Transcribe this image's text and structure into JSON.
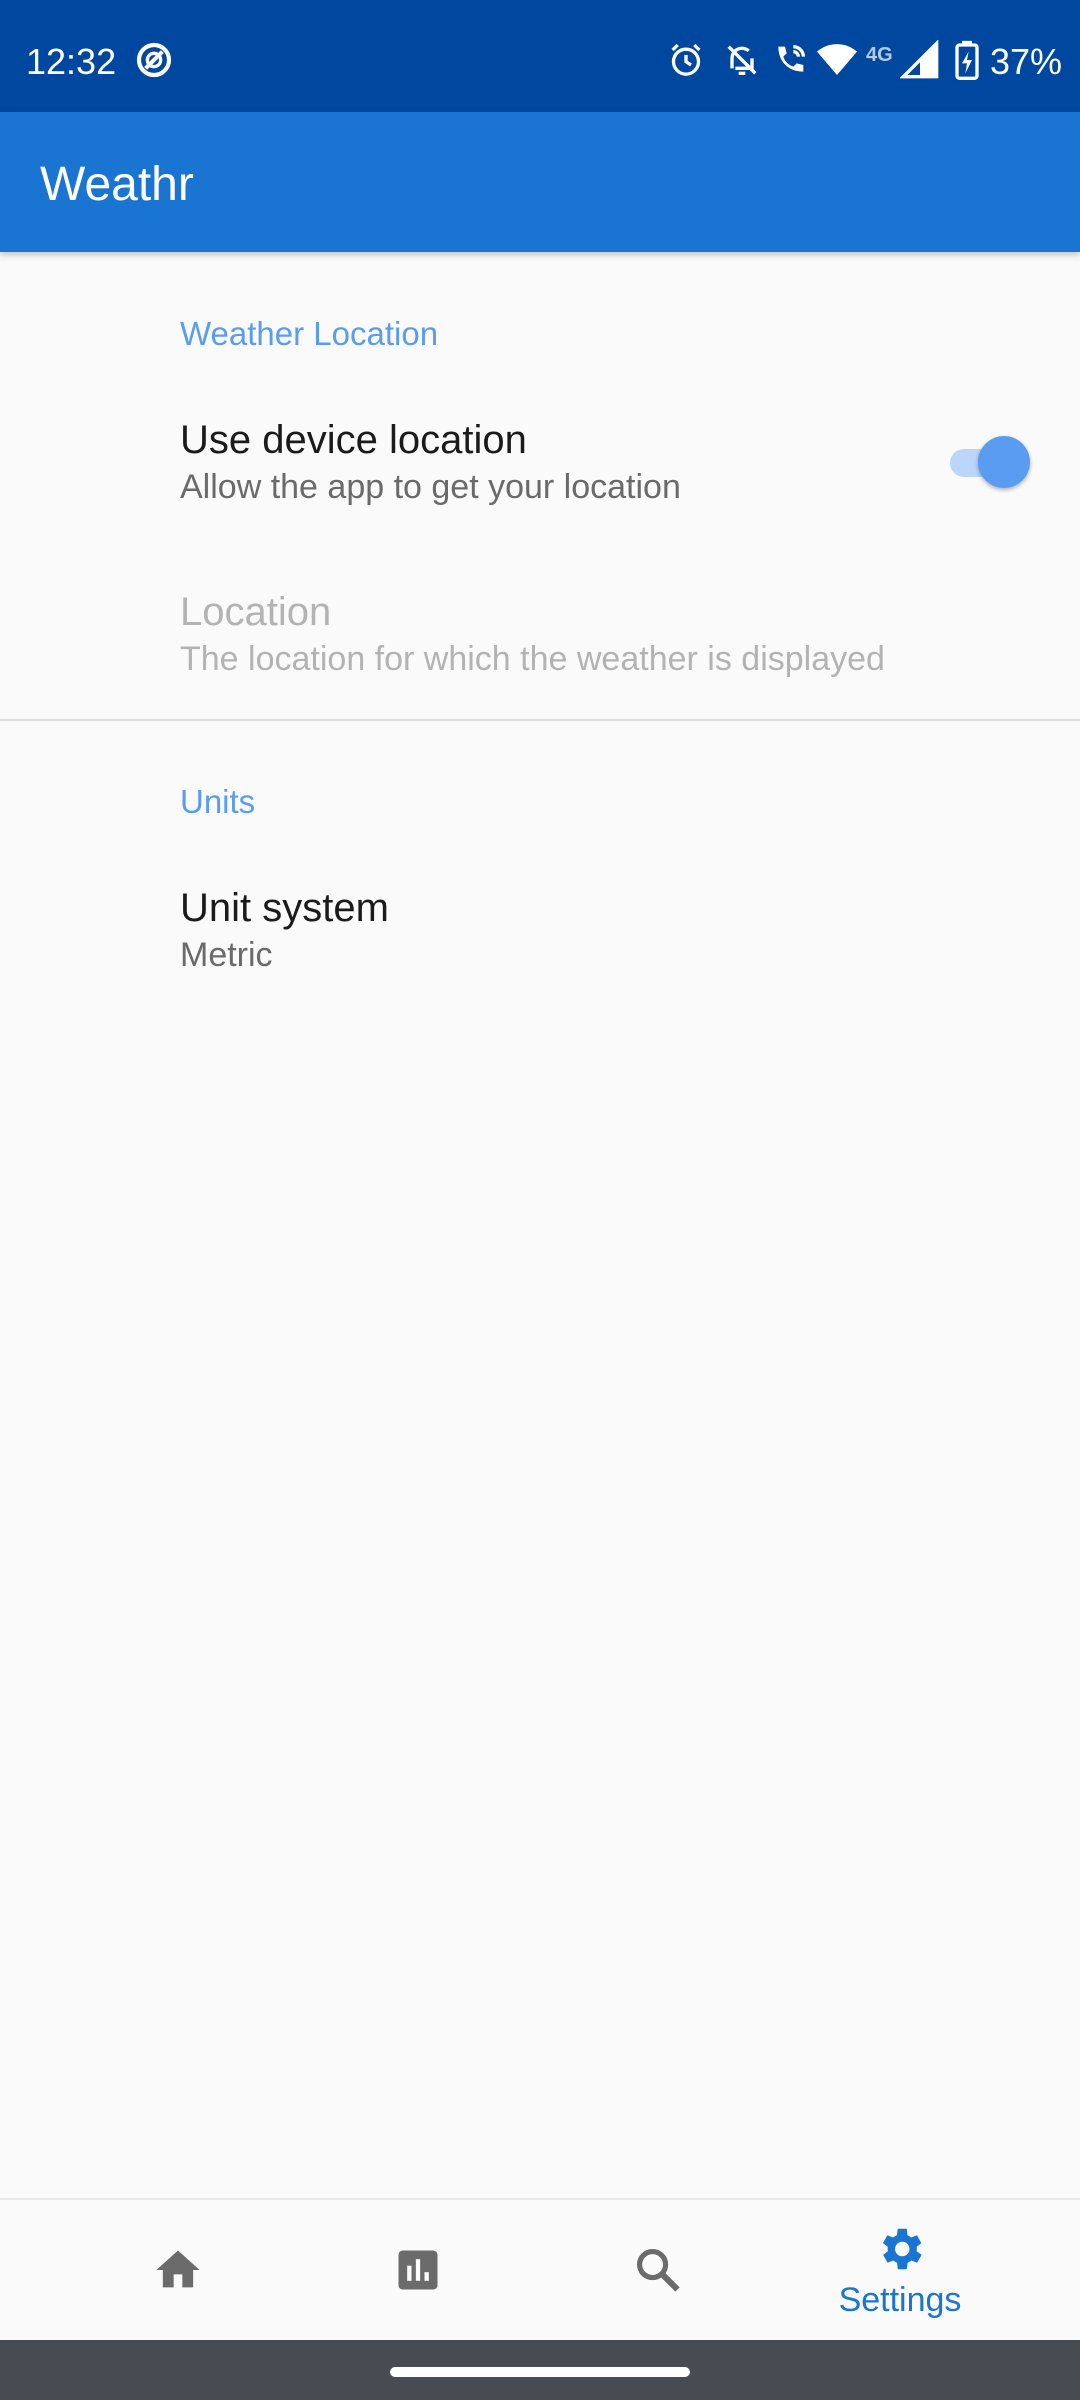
{
  "status_bar": {
    "time": "12:32",
    "network_label": "4G",
    "battery_percent": "37%",
    "icons": [
      "do-not-disturb-icon",
      "alarm-icon",
      "notifications-off-icon",
      "wifi-calling-icon",
      "wifi-icon",
      "cell-signal-icon",
      "battery-charging-icon"
    ]
  },
  "app_bar": {
    "title": "Weathr"
  },
  "sections": {
    "location": {
      "header": "Weather Location",
      "use_device_location": {
        "title": "Use device location",
        "summary": "Allow the app to get your location",
        "enabled": true
      },
      "location": {
        "title": "Location",
        "summary": "The location for which the weather is displayed",
        "disabled": true
      }
    },
    "units": {
      "header": "Units",
      "unit_system": {
        "title": "Unit system",
        "summary": "Metric"
      }
    }
  },
  "bottom_nav": {
    "items": [
      {
        "icon": "home-icon",
        "label": ""
      },
      {
        "icon": "chart-icon",
        "label": ""
      },
      {
        "icon": "search-icon",
        "label": ""
      },
      {
        "icon": "gear-icon",
        "label": "Settings",
        "selected": true
      }
    ]
  },
  "colors": {
    "status_bar": "#0047a0",
    "app_bar": "#1a75d2",
    "accent": "#5b9cf3",
    "nav_selected": "#1a75d2",
    "nav_inactive": "#6b6b6b"
  }
}
